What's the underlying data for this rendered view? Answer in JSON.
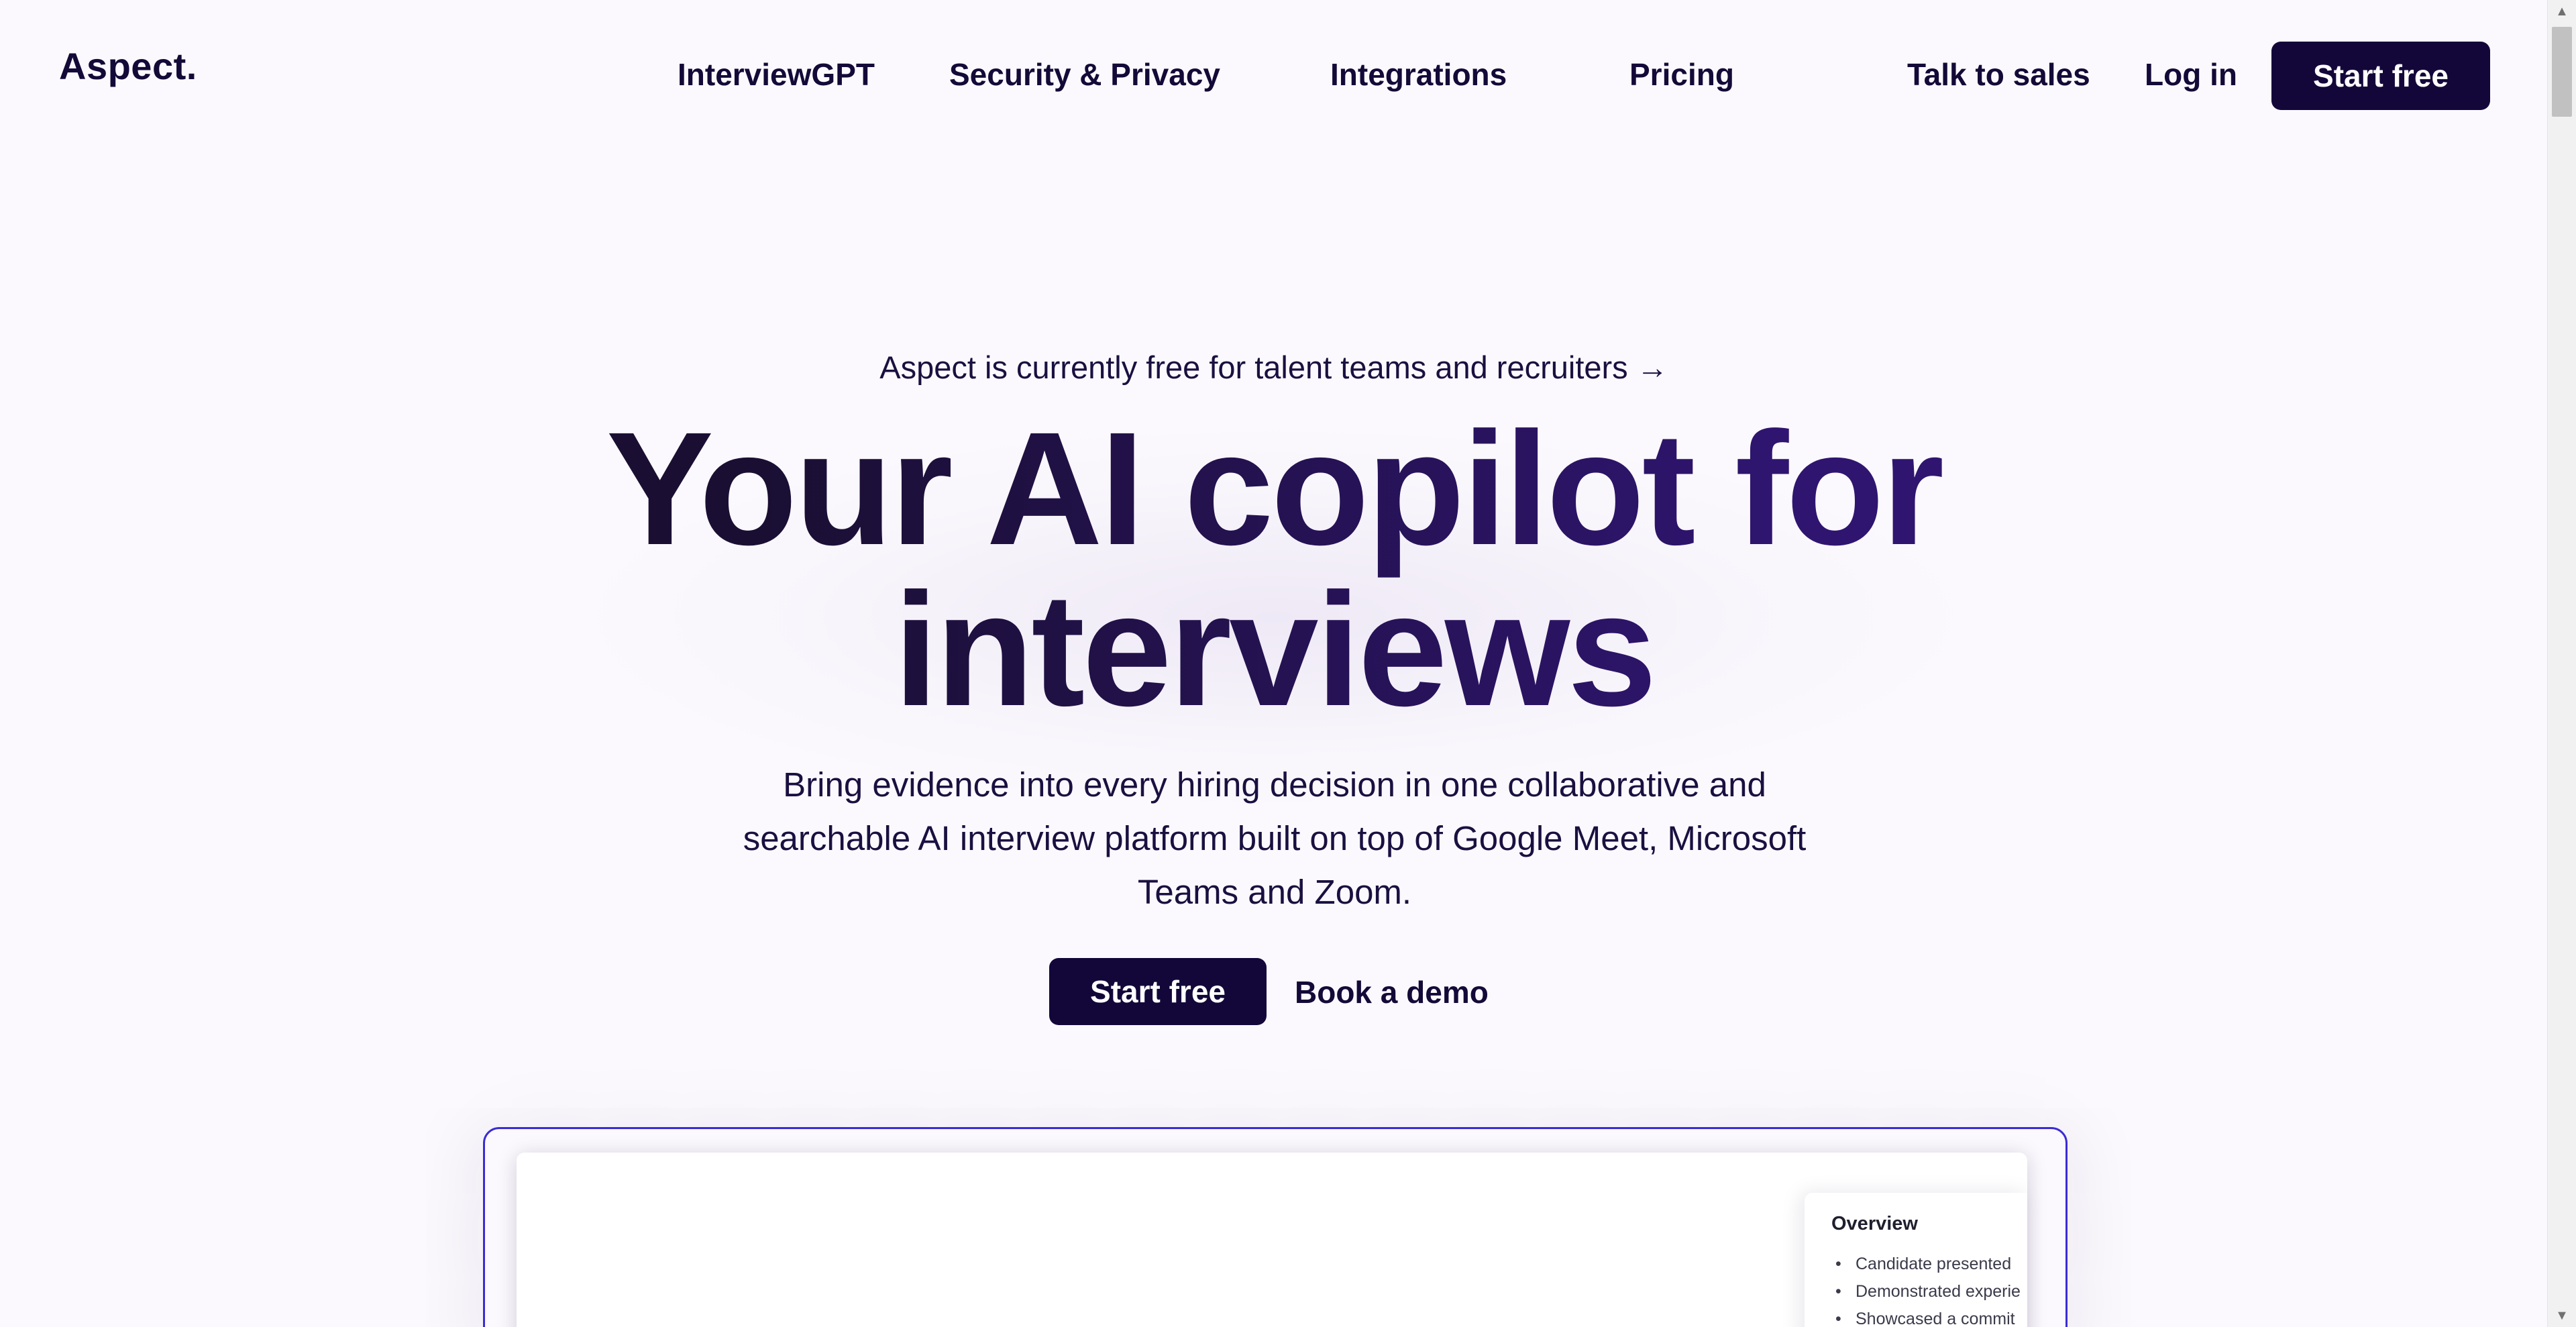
{
  "header": {
    "logo": "Aspect.",
    "nav": [
      {
        "label": "InterviewGPT"
      },
      {
        "label": "Security & Privacy"
      },
      {
        "label": "Integrations"
      },
      {
        "label": "Pricing"
      }
    ],
    "talk_to_sales": "Talk to sales",
    "log_in": "Log in",
    "start_free": "Start free"
  },
  "hero": {
    "announcement": "Aspect is currently free for talent teams and recruiters →",
    "headline_line1": "Your AI copilot for",
    "headline_line2": "interviews",
    "subheadline": "Bring evidence into every hiring decision in one collaborative and searchable AI interview platform built on top of Google Meet, Microsoft Teams and Zoom.",
    "cta_primary": "Start free",
    "cta_secondary": "Book a demo"
  },
  "preview": {
    "overview_title": "Overview",
    "bullets": [
      "Candidate presented",
      "Demonstrated experie",
      "Showcased a commit"
    ]
  },
  "colors": {
    "brand_dark": "#13073a",
    "background": "#fbf9fd",
    "frame_border": "#3b2bd6"
  }
}
